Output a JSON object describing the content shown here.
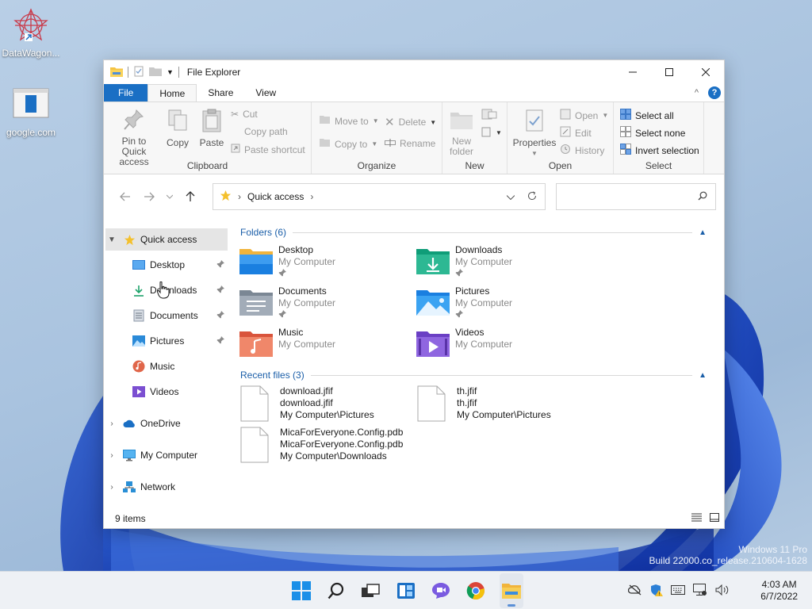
{
  "desktop": {
    "icons": [
      {
        "label": "DataWagon..."
      },
      {
        "label": "google.com"
      }
    ],
    "watermark": {
      "line1": "Windows 11 Pro",
      "line2": "Build 22000.co_release.210604-1628"
    }
  },
  "window": {
    "title": "File Explorer",
    "tabs": {
      "file": "File",
      "home": "Home",
      "share": "Share",
      "view": "View"
    },
    "help": "?",
    "ribbon": {
      "clipboard": {
        "label": "Clipboard",
        "pin_line1": "Pin to Quick",
        "pin_line2": "access",
        "copy": "Copy",
        "paste": "Paste",
        "cut": "Cut",
        "copy_path": "Copy path",
        "paste_shortcut": "Paste shortcut"
      },
      "organize": {
        "label": "Organize",
        "move_to": "Move to",
        "copy_to": "Copy to",
        "delete": "Delete",
        "rename": "Rename"
      },
      "new": {
        "label": "New",
        "new_line1": "New",
        "new_line2": "folder"
      },
      "open": {
        "label": "Open",
        "properties": "Properties",
        "open": "Open",
        "edit": "Edit",
        "history": "History"
      },
      "select": {
        "label": "Select",
        "select_all": "Select all",
        "select_none": "Select none",
        "invert": "Invert selection"
      }
    },
    "address": {
      "path": "Quick access",
      "search_placeholder": ""
    },
    "nav": {
      "quick_access": "Quick access",
      "items": [
        {
          "label": "Desktop"
        },
        {
          "label": "Downloads"
        },
        {
          "label": "Documents"
        },
        {
          "label": "Pictures"
        },
        {
          "label": "Music"
        },
        {
          "label": "Videos"
        }
      ],
      "onedrive": "OneDrive",
      "my_computer": "My Computer",
      "network": "Network"
    },
    "content": {
      "folders_header": "Folders (6)",
      "folders": [
        {
          "name": "Desktop",
          "location": "My Computer"
        },
        {
          "name": "Downloads",
          "location": "My Computer"
        },
        {
          "name": "Documents",
          "location": "My Computer"
        },
        {
          "name": "Pictures",
          "location": "My Computer"
        },
        {
          "name": "Music",
          "location": "My Computer"
        },
        {
          "name": "Videos",
          "location": "My Computer"
        }
      ],
      "recent_header": "Recent files (3)",
      "recent": [
        {
          "name": "download.jfif",
          "sub": "download.jfif",
          "path": "My Computer\\Pictures"
        },
        {
          "name": "th.jfif",
          "sub": "th.jfif",
          "path": "My Computer\\Pictures"
        },
        {
          "name": "MicaForEveryone.Config.pdb",
          "sub": "MicaForEveryone.Config.pdb",
          "path": "My Computer\\Downloads"
        }
      ]
    },
    "status": {
      "items": "9 items"
    }
  },
  "taskbar": {
    "time": "4:03 AM",
    "date": "6/7/2022"
  }
}
